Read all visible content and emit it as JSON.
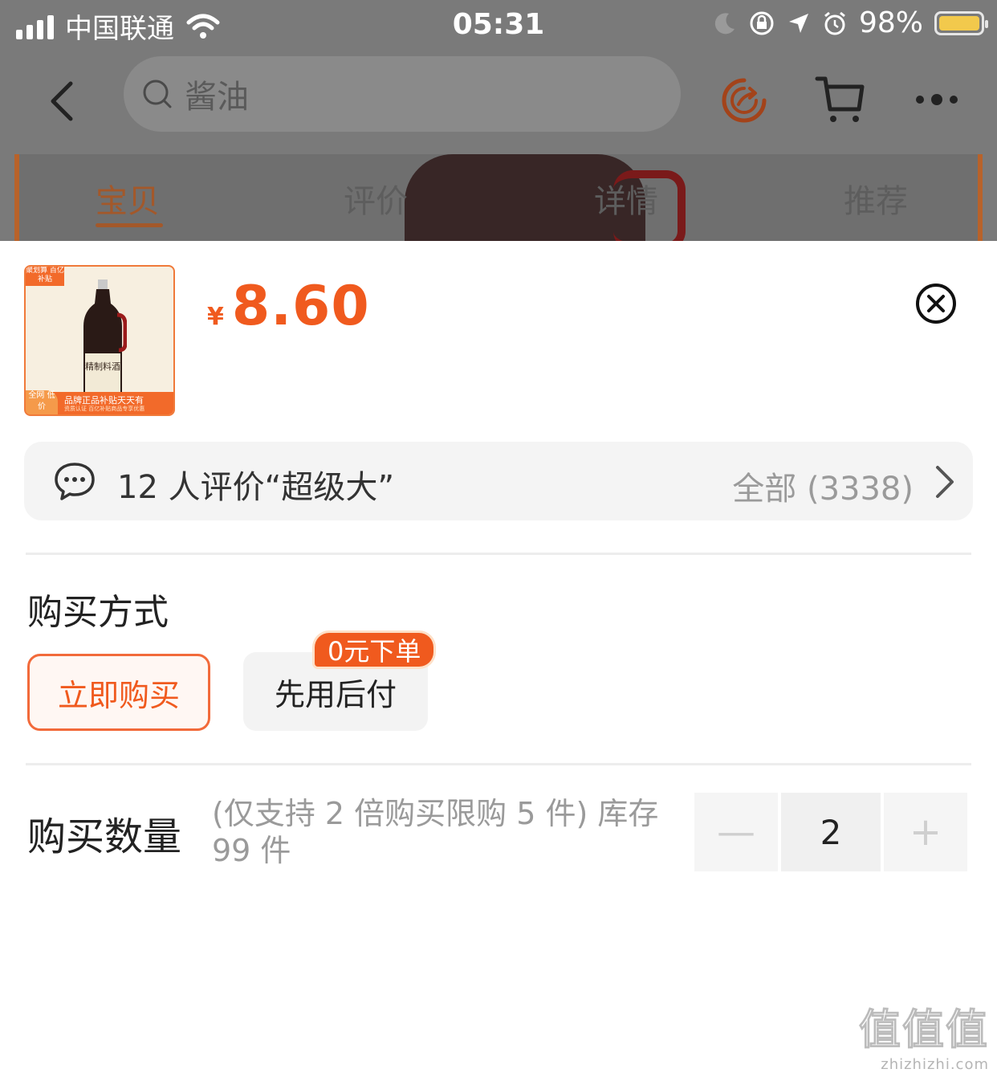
{
  "status_bar": {
    "carrier": "中国联通",
    "time": "05:31",
    "battery": "98%"
  },
  "nav": {
    "search_query": "酱油"
  },
  "tabs": [
    "宝贝",
    "评价",
    "详情",
    "推荐"
  ],
  "product": {
    "thumb_badge": "聚划算 百亿补贴",
    "thumb_label": "精制料酒",
    "thumb_strip": "品牌正品补贴天天有",
    "thumb_strip_sub": "资质认证 百亿补贴商品专享优惠",
    "thumb_low_price": "全网 低价",
    "price_currency": "¥",
    "price": "8.60"
  },
  "review": {
    "summary": "12 人评价“超级大”",
    "all": "全部 (3338)"
  },
  "purchase_method": {
    "title": "购买方式",
    "options": [
      "立即购买",
      "先用后付"
    ],
    "selected": "立即购买",
    "later_tag": "0元下单"
  },
  "quantity": {
    "title": "购买数量",
    "note": "(仅支持 2 倍购买限购 5 件) 库存 99 件",
    "value": "2",
    "minus": "—",
    "plus": "+"
  },
  "watermark": {
    "logo": "值值值",
    "url": "zhizhizhi.com"
  },
  "colors": {
    "accent": "#f05a1e",
    "dim_overlay": "#7a7a7a"
  }
}
